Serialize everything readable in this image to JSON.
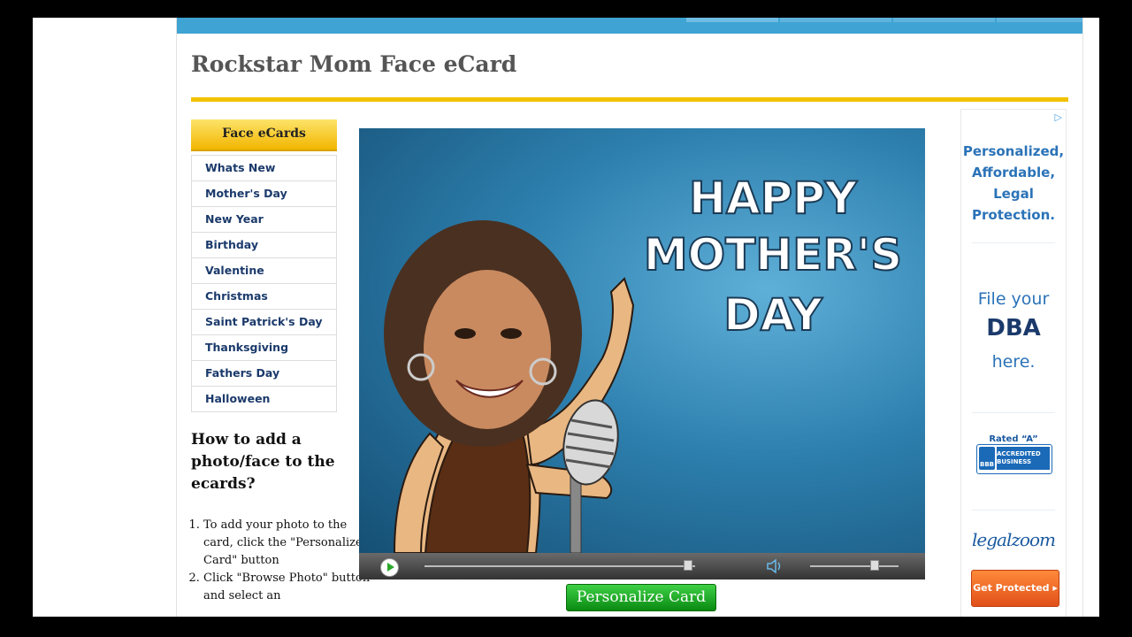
{
  "page": {
    "title": "Rockstar Mom Face eCard"
  },
  "sidebar": {
    "heading": "Face eCards",
    "items": [
      {
        "label": "Whats New"
      },
      {
        "label": "Mother's Day"
      },
      {
        "label": "New Year"
      },
      {
        "label": "Birthday"
      },
      {
        "label": "Valentine"
      },
      {
        "label": "Christmas"
      },
      {
        "label": "Saint Patrick's Day"
      },
      {
        "label": "Thanksgiving"
      },
      {
        "label": "Fathers Day"
      },
      {
        "label": "Halloween"
      }
    ]
  },
  "howto": {
    "heading": "How to add a photo/face to the ecards?",
    "steps": [
      "To add your photo to the card, click the \"Personalize Card\" button",
      "Click \"Browse Photo\" button and select an"
    ]
  },
  "card": {
    "greeting_line1": "HAPPY",
    "greeting_line2": "MOTHER'S",
    "greeting_line3": "DAY",
    "icons": {
      "play": "play-icon",
      "volume": "speaker-icon"
    },
    "playback_progress": 0.97,
    "volume_level": 0.72
  },
  "actions": {
    "personalize_label": "Personalize Card"
  },
  "ad": {
    "badge": "▷",
    "line1": "Personalized,",
    "line2": "Affordable,",
    "line3": "Legal",
    "line4": "Protection.",
    "dba_pre": "File your",
    "dba_main": "DBA",
    "dba_post": "here.",
    "rated": "Rated “A”",
    "bbb_logo": "BBB",
    "bbb_text": "ACCREDITED BUSINESS",
    "brand": "legalzoom",
    "cta": "Get Protected ▸"
  },
  "colors": {
    "accent_blue": "#3fa3d3",
    "rule_yellow": "#f2c200",
    "button_green": "#1aa322",
    "link_navy": "#1b3a6b"
  }
}
